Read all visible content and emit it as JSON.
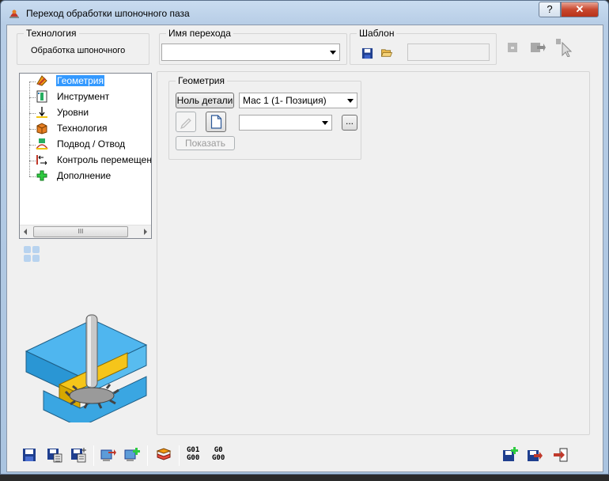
{
  "window": {
    "title": "Переход обработки шпоночного паза",
    "help_label": "?",
    "close_label": "✕"
  },
  "technology": {
    "group_label": "Технология",
    "value": "Обработка шпоночного"
  },
  "pass_name": {
    "group_label": "Имя перехода",
    "value": ""
  },
  "template": {
    "group_label": "Шаблон",
    "value": ""
  },
  "tree": {
    "items": [
      {
        "label": "Геометрия",
        "icon": "geometry-icon",
        "selected": true
      },
      {
        "label": "Инструмент",
        "icon": "tool-icon"
      },
      {
        "label": "Уровни",
        "icon": "levels-icon"
      },
      {
        "label": "Технология",
        "icon": "technology-icon"
      },
      {
        "label": "Подвод / Отвод",
        "icon": "approach-retract-icon"
      },
      {
        "label": "Контроль перемещен",
        "icon": "motion-control-icon"
      },
      {
        "label": "Дополнение",
        "icon": "addition-icon"
      }
    ],
    "scroll_thumb": "III"
  },
  "geometry": {
    "group_label": "Геометрия",
    "part_zero_label": "Ноль детали",
    "mac_value": "Мас 1 (1- Позиция)",
    "geometry_value": "",
    "browse_label": "...",
    "show_label": "Показать"
  },
  "bottom": {
    "g01_top": "G01",
    "g01_bottom": "G00",
    "g0_top": "G0",
    "g0_bottom": "G00"
  },
  "colors": {
    "accent": "#3399ff",
    "window_frame": "#aac4e0"
  }
}
